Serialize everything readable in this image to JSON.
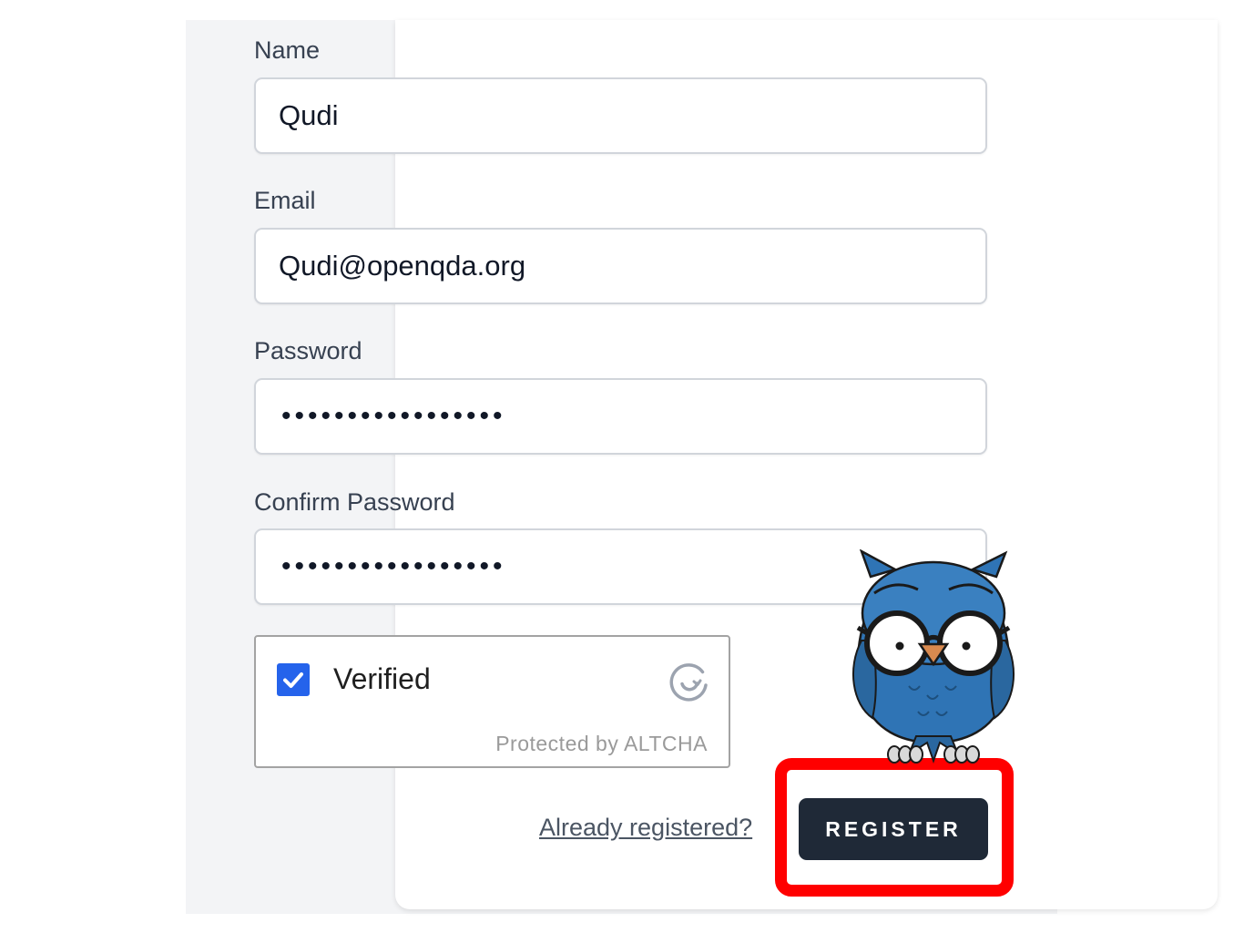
{
  "form": {
    "name_label": "Name",
    "name_value": "Qudi",
    "email_label": "Email",
    "email_value": "Qudi@openqda.org",
    "password_label": "Password",
    "password_value": "Qudi@openqda.org1",
    "confirm_password_label": "Confirm Password",
    "confirm_password_value": "Qudi@openqda.org1"
  },
  "captcha": {
    "status_label": "Verified",
    "footer_text": "Protected by ALTCHA",
    "checked": true
  },
  "actions": {
    "login_link": "Already registered?",
    "register_label": "REGISTER"
  },
  "colors": {
    "accent_checkbox": "#2563eb",
    "button_bg": "#1f2937",
    "highlight": "#ff0000",
    "owl_body": "#2f74b5"
  }
}
